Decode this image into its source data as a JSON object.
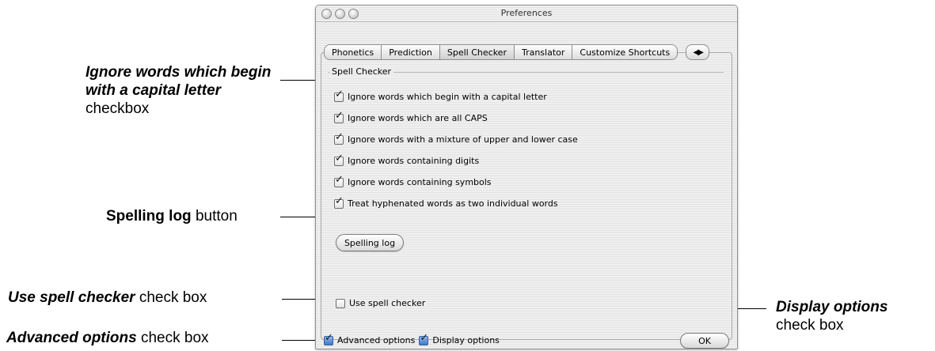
{
  "window": {
    "title": "Preferences"
  },
  "tabs": [
    {
      "label": "Phonetics"
    },
    {
      "label": "Prediction"
    },
    {
      "label": "Spell Checker"
    },
    {
      "label": "Translator"
    },
    {
      "label": "Customize Shortcuts"
    }
  ],
  "tab_scroll_glyph": "◀▶",
  "spell_checker": {
    "group_title": "Spell Checker",
    "options": [
      {
        "label": "Ignore words which begin with a capital letter",
        "checked": true
      },
      {
        "label": "Ignore words which are all CAPS",
        "checked": true
      },
      {
        "label": "Ignore words with a mixture of upper and lower case",
        "checked": true
      },
      {
        "label": "Ignore words containing digits",
        "checked": true
      },
      {
        "label": "Ignore words containing symbols",
        "checked": true
      },
      {
        "label": "Treat hyphenated words as two individual words",
        "checked": true
      }
    ],
    "spelling_log_button": "Spelling log",
    "use_spell_checker": {
      "label": "Use spell checker",
      "checked": false
    }
  },
  "footer": {
    "advanced_options": {
      "label": "Advanced options",
      "checked": true
    },
    "display_options": {
      "label": "Display options",
      "checked": true
    },
    "ok_button": "OK"
  },
  "check_glyph": "✓",
  "callouts": {
    "ignore_caps": {
      "bold_italic": "Ignore words which begin with a capital letter",
      "plain": "checkbox"
    },
    "spelling_log": {
      "bold": "Spelling log",
      "plain": "button"
    },
    "use_spell_checker": {
      "bold_italic": "Use spell checker",
      "plain": "check box"
    },
    "advanced_options": {
      "bold_italic": "Advanced options",
      "plain": "check box"
    },
    "display_options": {
      "bold_italic": "Display options",
      "plain": "check box"
    }
  }
}
